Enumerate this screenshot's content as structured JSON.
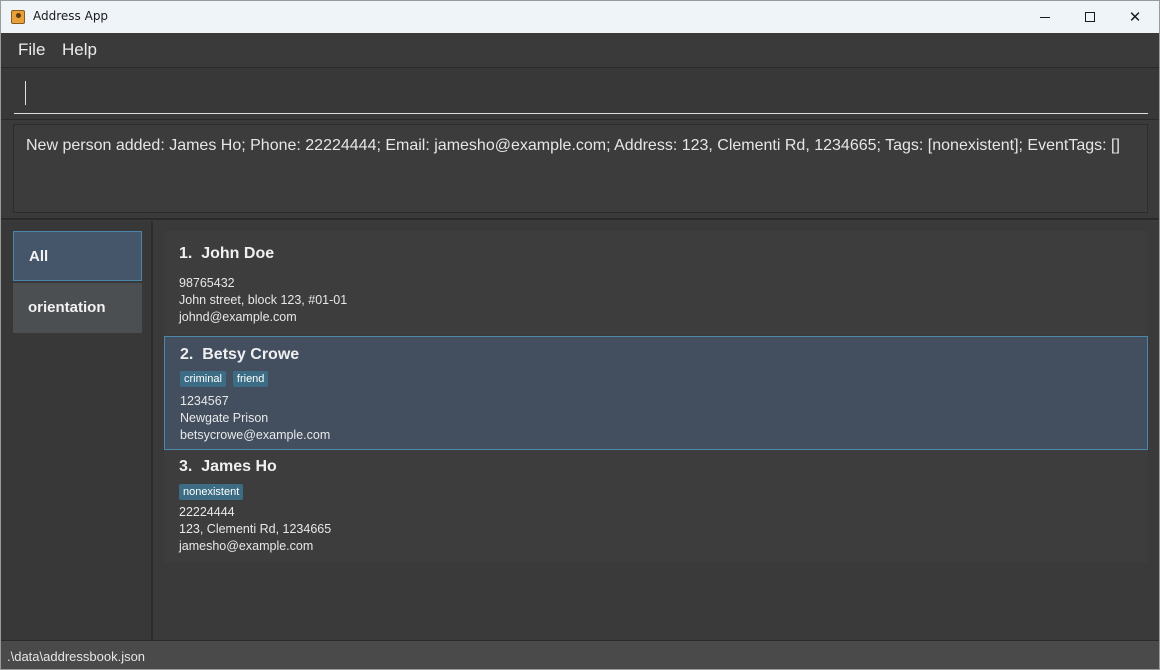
{
  "window": {
    "title": "Address App",
    "controls": {
      "minimize": "—",
      "maximize": "☐",
      "close": "✕"
    }
  },
  "menu": {
    "file": "File",
    "help": "Help"
  },
  "command": {
    "value": "",
    "placeholder": ""
  },
  "result": {
    "message": "New person added: James Ho; Phone: 22224444; Email: jamesho@example.com; Address: 123, Clementi Rd, 1234665; Tags: [nonexistent]; EventTags: []"
  },
  "sidebar": {
    "items": [
      {
        "label": "All"
      },
      {
        "label": "orientation"
      }
    ]
  },
  "persons": [
    {
      "index": "1.",
      "name": "John Doe",
      "tags": [],
      "phone": "98765432",
      "address": "John street, block 123, #01-01",
      "email": "johnd@example.com"
    },
    {
      "index": "2.",
      "name": "Betsy Crowe",
      "tags": [
        "criminal",
        "friend"
      ],
      "phone": "1234567",
      "address": "Newgate Prison",
      "email": "betsycrowe@example.com"
    },
    {
      "index": "3.",
      "name": "James Ho",
      "tags": [
        "nonexistent"
      ],
      "phone": "22224444",
      "address": "123, Clementi Rd, 1234665",
      "email": "jamesho@example.com"
    }
  ],
  "status": {
    "path": ".\\data\\addressbook.json"
  },
  "colors": {
    "background": "#3c3c3c",
    "selected_card": "#434e5f",
    "tag": "#3c6d84",
    "sidebar_selected": "#45556a"
  }
}
